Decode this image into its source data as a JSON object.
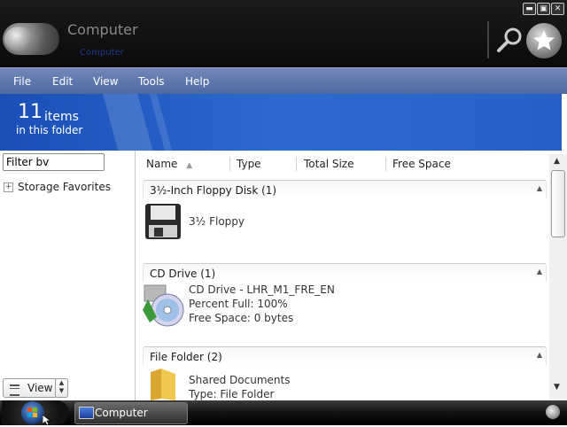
{
  "window": {
    "title": "Computer",
    "subtitle": "Computer"
  },
  "window_buttons": {
    "minimize": "▬",
    "maximize": "▣",
    "close": "✕"
  },
  "menu": [
    {
      "label": "File"
    },
    {
      "label": "Edit"
    },
    {
      "label": "View"
    },
    {
      "label": "Tools"
    },
    {
      "label": "Help"
    }
  ],
  "banner": {
    "count": "11",
    "count_unit": "items",
    "count_sub": "in this folder"
  },
  "left_pane": {
    "filter_value": "Filter bv",
    "storage_favorites": "Storage Favorites",
    "view_button": "View"
  },
  "columns": [
    {
      "label": "Name",
      "sort": "▲"
    },
    {
      "label": "Type"
    },
    {
      "label": "Total Size"
    },
    {
      "label": "Free Space"
    }
  ],
  "groups": [
    {
      "label": "3½-Inch Floppy Disk (1)",
      "items": [
        {
          "name": "3½ Floppy"
        }
      ]
    },
    {
      "label": "CD Drive (1)",
      "items": [
        {
          "name": "CD Drive - LHR_M1_FRE_EN",
          "line2": "Percent Full: 100%",
          "line3": "Free Space: 0 bytes"
        }
      ]
    },
    {
      "label": "File Folder (2)",
      "items": [
        {
          "name": "Shared Documents",
          "line2": "Type: File Folder"
        }
      ]
    }
  ],
  "taskbar": {
    "item": "Computer"
  },
  "colors": {
    "menubar": "#5b73aa",
    "banner": "#2560c8",
    "titlebar": "#121212"
  }
}
